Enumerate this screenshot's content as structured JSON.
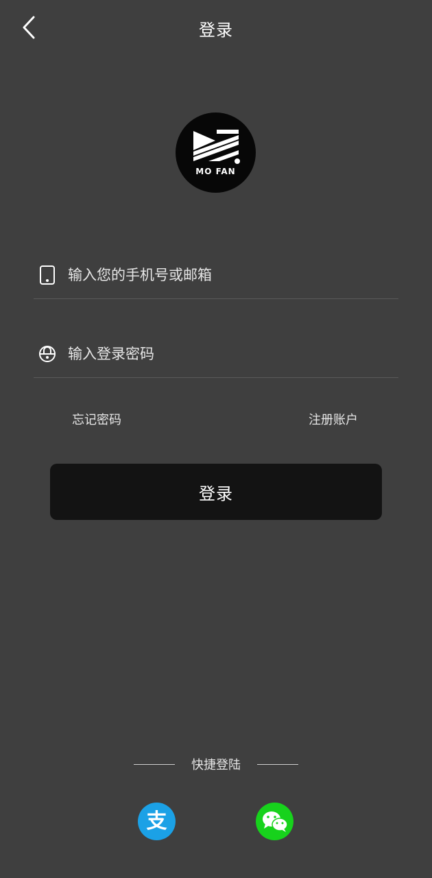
{
  "header": {
    "title": "登录"
  },
  "logo": {
    "text": "MO FAN"
  },
  "form": {
    "account_placeholder": "输入您的手机号或邮箱",
    "password_placeholder": "输入登录密码"
  },
  "links": {
    "forgot": "忘记密码",
    "register": "注册账户"
  },
  "login_button": "登录",
  "quick_login": {
    "label": "快捷登陆",
    "alipay_glyph": "支",
    "alipay_color": "#1ba1e6",
    "wechat_color": "#17d21c"
  },
  "colors": {
    "background": "#3f3f3f",
    "button": "#131313"
  }
}
